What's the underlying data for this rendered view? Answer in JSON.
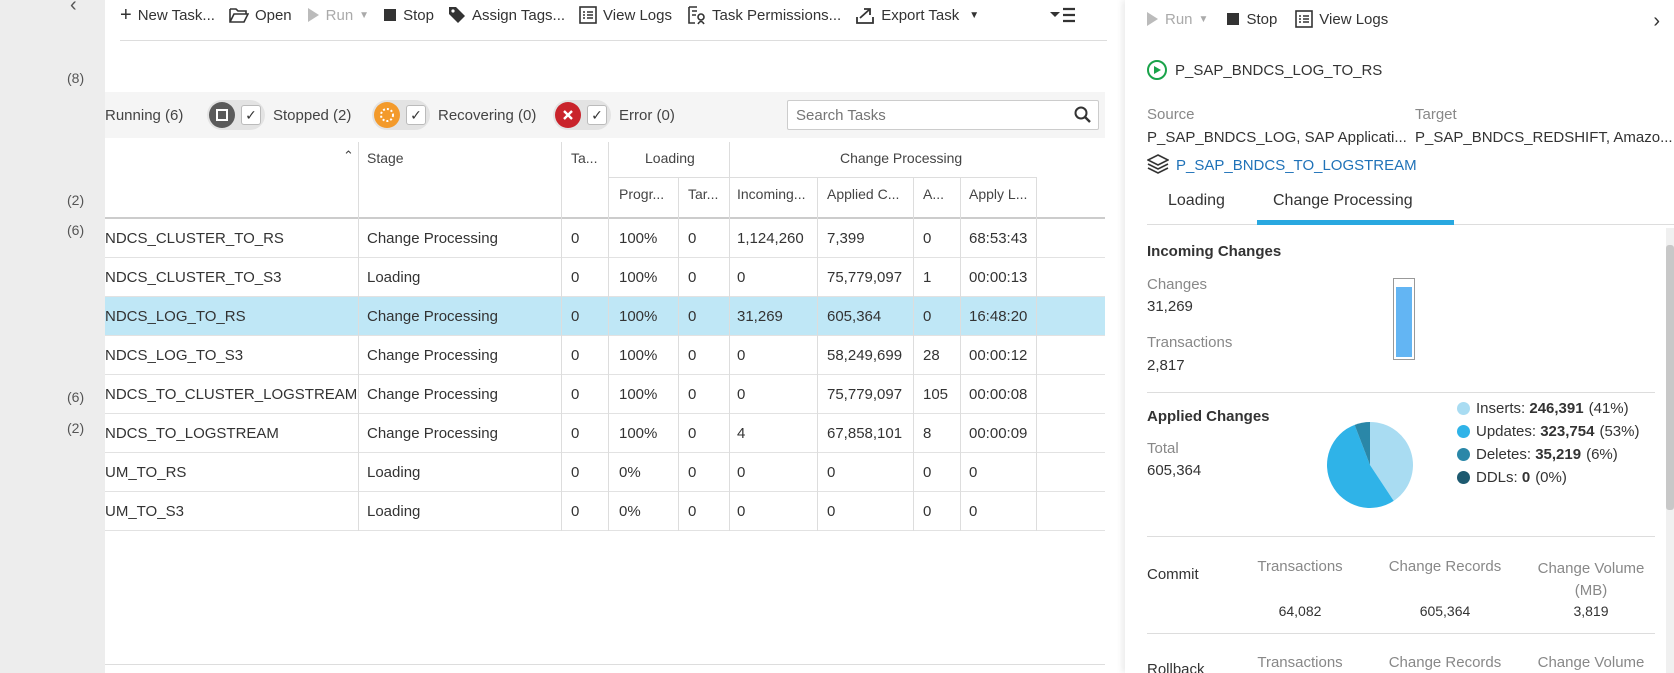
{
  "left": {
    "counts": [
      "(8)",
      "(2)",
      "(6)",
      "(6)",
      "(2)"
    ]
  },
  "toolbar": {
    "new_task": "New Task...",
    "open": "Open",
    "run": "Run",
    "stop": "Stop",
    "assign_tags": "Assign Tags...",
    "view_logs": "View Logs",
    "task_permissions": "Task Permissions...",
    "export_task": "Export Task"
  },
  "filters": {
    "running": "Running (6)",
    "stopped": "Stopped (2)",
    "recovering": "Recovering (0)",
    "error": "Error (0)",
    "check": "✓"
  },
  "search": {
    "placeholder": "Search Tasks"
  },
  "grid": {
    "headers": {
      "stage": "Stage",
      "tables": "Ta...",
      "loading": "Loading",
      "change_processing": "Change Processing",
      "progress": "Progr...",
      "target": "Tar...",
      "incoming": "Incoming...",
      "applied": "Applied C...",
      "a": "A...",
      "apply_latency": "Apply L..."
    },
    "rows": [
      {
        "name": "NDCS_CLUSTER_TO_RS",
        "stage": "Change Processing",
        "tables": "0",
        "progress": "100%",
        "target": "0",
        "incoming": "1,124,260",
        "applied": "7,399",
        "a": "0",
        "latency": "68:53:43"
      },
      {
        "name": "NDCS_CLUSTER_TO_S3",
        "stage": "Loading",
        "tables": "0",
        "progress": "100%",
        "target": "0",
        "incoming": "0",
        "applied": "75,779,097",
        "a": "1",
        "latency": "00:00:13"
      },
      {
        "name": "NDCS_LOG_TO_RS",
        "stage": "Change Processing",
        "tables": "0",
        "progress": "100%",
        "target": "0",
        "incoming": "31,269",
        "applied": "605,364",
        "a": "0",
        "latency": "16:48:20"
      },
      {
        "name": "NDCS_LOG_TO_S3",
        "stage": "Change Processing",
        "tables": "0",
        "progress": "100%",
        "target": "0",
        "incoming": "0",
        "applied": "58,249,699",
        "a": "28",
        "latency": "00:00:12"
      },
      {
        "name": "NDCS_TO_CLUSTER_LOGSTREAM",
        "stage": "Change Processing",
        "tables": "0",
        "progress": "100%",
        "target": "0",
        "incoming": "0",
        "applied": "75,779,097",
        "a": "105",
        "latency": "00:00:08"
      },
      {
        "name": "NDCS_TO_LOGSTREAM",
        "stage": "Change Processing",
        "tables": "0",
        "progress": "100%",
        "target": "0",
        "incoming": "4",
        "applied": "67,858,101",
        "a": "8",
        "latency": "00:00:09"
      },
      {
        "name": "UM_TO_RS",
        "stage": "Loading",
        "tables": "0",
        "progress": "0%",
        "target": "0",
        "incoming": "0",
        "applied": "0",
        "a": "0",
        "latency": "0"
      },
      {
        "name": "UM_TO_S3",
        "stage": "Loading",
        "tables": "0",
        "progress": "0%",
        "target": "0",
        "incoming": "0",
        "applied": "0",
        "a": "0",
        "latency": "0"
      }
    ]
  },
  "panel": {
    "run": "Run",
    "stop": "Stop",
    "view_logs": "View Logs",
    "task_name": "P_SAP_BNDCS_LOG_TO_RS",
    "source_label": "Source",
    "source_value": "P_SAP_BNDCS_LOG, SAP Applicati...",
    "target_label": "Target",
    "target_value": "P_SAP_BNDCS_REDSHIFT, Amazo...",
    "logstream_link": "P_SAP_BNDCS_TO_LOGSTREAM",
    "tab_loading": "Loading",
    "tab_change_processing": "Change Processing",
    "incoming_title": "Incoming Changes",
    "changes_label": "Changes",
    "changes_value": "31,269",
    "transactions_label": "Transactions",
    "transactions_value": "2,817",
    "incoming_bar_fill": 0.92,
    "applied_title": "Applied Changes",
    "total_label": "Total",
    "total_value": "605,364",
    "legend": [
      {
        "label": "Inserts: ",
        "value": "246,391",
        "pct": "(41%)",
        "color": "#a9dcf2"
      },
      {
        "label": "Updates: ",
        "value": "323,754",
        "pct": "(53%)",
        "color": "#2fb3e8"
      },
      {
        "label": "Deletes: ",
        "value": "35,219",
        "pct": "(6%)",
        "color": "#2a87a8"
      },
      {
        "label": "DDLs: ",
        "value": "0",
        "pct": "(0%)",
        "color": "#1d5a70"
      }
    ],
    "commit_label": "Commit",
    "rollback_label": "Rollback",
    "col_transactions": "Transactions",
    "col_change_records": "Change Records",
    "col_change_volume": "Change Volume (MB)",
    "col_change_volume_short": "Change Volume",
    "commit_transactions": "64,082",
    "commit_records": "605,364",
    "commit_volume": "3,819"
  },
  "colors": {
    "selected_row": "#bfe7f6",
    "tab_underline": "#29a8e0",
    "stopped_icon": "#5a5a5a",
    "recovering_icon": "#f39a2b",
    "error_icon": "#c9232b",
    "running_icon": "#1aa34a"
  }
}
